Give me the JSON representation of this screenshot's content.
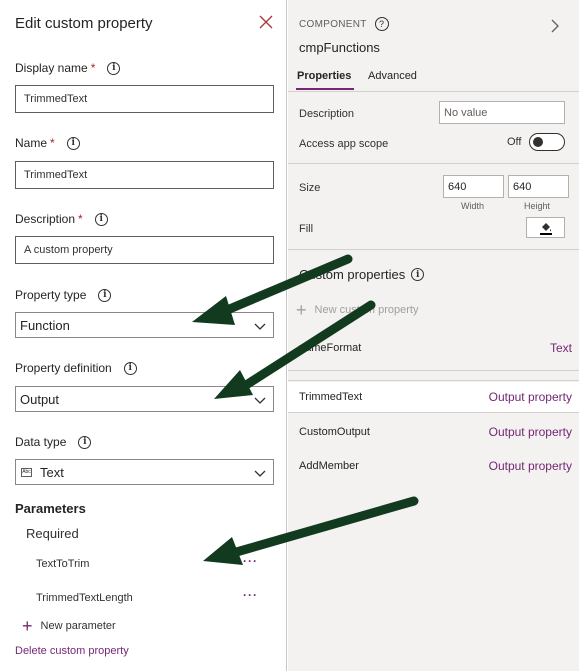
{
  "left_panel": {
    "title": "Edit custom property",
    "display_name": {
      "label": "Display name",
      "required_mark": "*",
      "value": "TrimmedText"
    },
    "name": {
      "label": "Name",
      "required_mark": "*",
      "value": "TrimmedText"
    },
    "description": {
      "label": "Description",
      "required_mark": "*",
      "value": "A custom property"
    },
    "property_type": {
      "label": "Property type",
      "value": "Function"
    },
    "property_definition": {
      "label": "Property definition",
      "value": "Output"
    },
    "data_type": {
      "label": "Data type",
      "value": "Text",
      "icon_text": "Abc"
    },
    "parameters": {
      "heading": "Parameters",
      "required_label": "Required",
      "items": [
        {
          "name": "TextToTrim",
          "more": "···"
        },
        {
          "name": "TrimmedTextLength",
          "more": "···"
        }
      ],
      "new_parameter": "New parameter"
    },
    "delete_link": "Delete custom property"
  },
  "right_panel": {
    "component_label": "COMPONENT",
    "component_name": "cmpFunctions",
    "tabs": [
      "Properties",
      "Advanced"
    ],
    "description": {
      "label": "Description",
      "placeholder": "No value"
    },
    "access_app_scope": {
      "label": "Access app scope",
      "state": "Off"
    },
    "size": {
      "label": "Size",
      "width": "640",
      "height": "640",
      "width_label": "Width",
      "height_label": "Height"
    },
    "fill": {
      "label": "Fill"
    },
    "custom_properties": {
      "heading": "Custom properties",
      "new_label": "New custom property",
      "items": [
        {
          "name": "nameFormat",
          "type": "Text"
        },
        {
          "name": "TrimmedText",
          "type": "Output property"
        },
        {
          "name": "CustomOutput",
          "type": "Output property"
        },
        {
          "name": "AddMember",
          "type": "Output property"
        }
      ]
    }
  },
  "colors": {
    "accent": "#742774",
    "required": "#a4262c",
    "arrow": "#123a1f"
  }
}
